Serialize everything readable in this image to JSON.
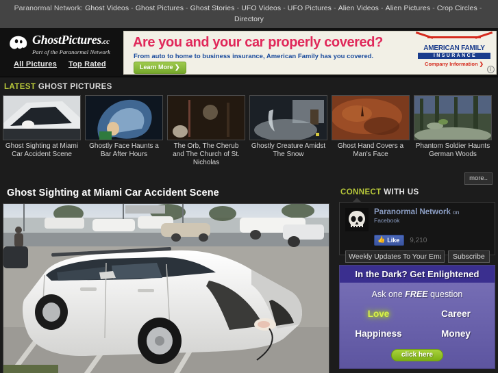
{
  "network_nav": {
    "lead": "Paranormal Network:",
    "items": [
      "Ghost Videos",
      "Ghost Pictures",
      "Ghost Stories",
      "UFO Videos",
      "UFO Pictures",
      "Alien Videos",
      "Alien Pictures",
      "Crop Circles",
      "Directory"
    ],
    "separator": "-"
  },
  "brand": {
    "name": "GhostPictures",
    "tld": ".cc",
    "tagline": "Part of the Paranormal Network",
    "icon": "ghost-icon"
  },
  "header_links": [
    {
      "label": "All Pictures"
    },
    {
      "label": "Top Rated"
    }
  ],
  "ad_banner": {
    "headline": "Are you and your car properly covered?",
    "subtext": "From auto to home to business insurance, American Family has you covered.",
    "cta": "Learn More",
    "cta_arrow": "❯",
    "brand_name": "AMERICAN FAMILY",
    "brand_sub": "INSURANCE",
    "company_info": "Company Information",
    "company_info_arrow": "❯",
    "adchoices_icon": "info-icon",
    "colors": {
      "headline": "#e0285a",
      "subtext": "#1a4b9c",
      "brand": "#1a3c8c",
      "accent_red": "#d52b1e"
    }
  },
  "latest_section": {
    "title_highlight": "LATEST",
    "title_rest": "GHOST PICTURES",
    "more_label": "more..",
    "thumbnails": [
      {
        "caption": "Ghost Sighting at Miami Car Accident Scene"
      },
      {
        "caption": "Ghostly Face Haunts a Bar After Hours"
      },
      {
        "caption": "The Orb, The Cherub and The Church of St. Nicholas"
      },
      {
        "caption": "Ghostly Creature Amidst The Snow"
      },
      {
        "caption": "Ghost Hand Covers a Man's Face"
      },
      {
        "caption": "Phantom Soldier Haunts German Woods"
      }
    ]
  },
  "main": {
    "page_title": "Ghost Sighting at Miami Car Accident Scene",
    "hero_alt": "white damaged station wagon in parking lot"
  },
  "connect": {
    "title_highlight": "CONNECT",
    "title_rest": "WITH US",
    "facebook": {
      "page_name": "Paranormal Network",
      "on_word": "on",
      "network": "Facebook",
      "like_label": "Like",
      "like_count": "9,210",
      "avatar_icon": "skull-icon",
      "thumbs_up_icon": "thumbs-up-icon"
    },
    "subscribe": {
      "input_value": "Weekly Updates To Your Email Address",
      "placeholder": "Weekly Updates To Your Email Address",
      "button_label": "Subscribe"
    }
  },
  "psychic_ad": {
    "heading": "In the Dark?  Get Enlightened",
    "subheading_before": "Ask one ",
    "subheading_em": "FREE",
    "subheading_after": " question",
    "options": [
      {
        "label": "Love",
        "highlighted": true
      },
      {
        "label": "Career",
        "highlighted": false
      },
      {
        "label": "Happiness",
        "highlighted": false
      },
      {
        "label": "Money",
        "highlighted": false
      }
    ],
    "button_label": "click here",
    "colors": {
      "header_bg": "#3a2f8f",
      "body_bg": "#6d65ae",
      "highlight": "#d9f24a",
      "button": "#8cc01e"
    }
  }
}
